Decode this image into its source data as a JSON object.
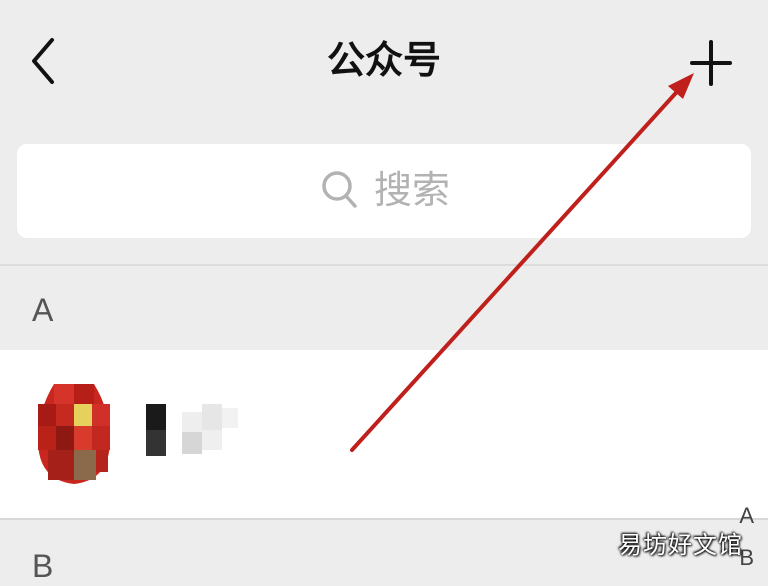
{
  "header": {
    "title": "公众号",
    "back_icon": "chevron-left-icon",
    "add_icon": "plus-icon"
  },
  "search": {
    "placeholder": "搜索",
    "icon": "search-icon"
  },
  "sections": [
    {
      "letter": "A"
    },
    {
      "letter": "B"
    }
  ],
  "list": {
    "items": [
      {
        "avatar": "mosaic-avatar",
        "name": ""
      }
    ]
  },
  "index_bar": {
    "letters": [
      "A",
      "B"
    ]
  },
  "watermark": "易坊好文馆",
  "colors": {
    "background": "#ededed",
    "card": "#ffffff",
    "annotation_arrow": "#c0201c",
    "placeholder": "#b2b2b2"
  }
}
